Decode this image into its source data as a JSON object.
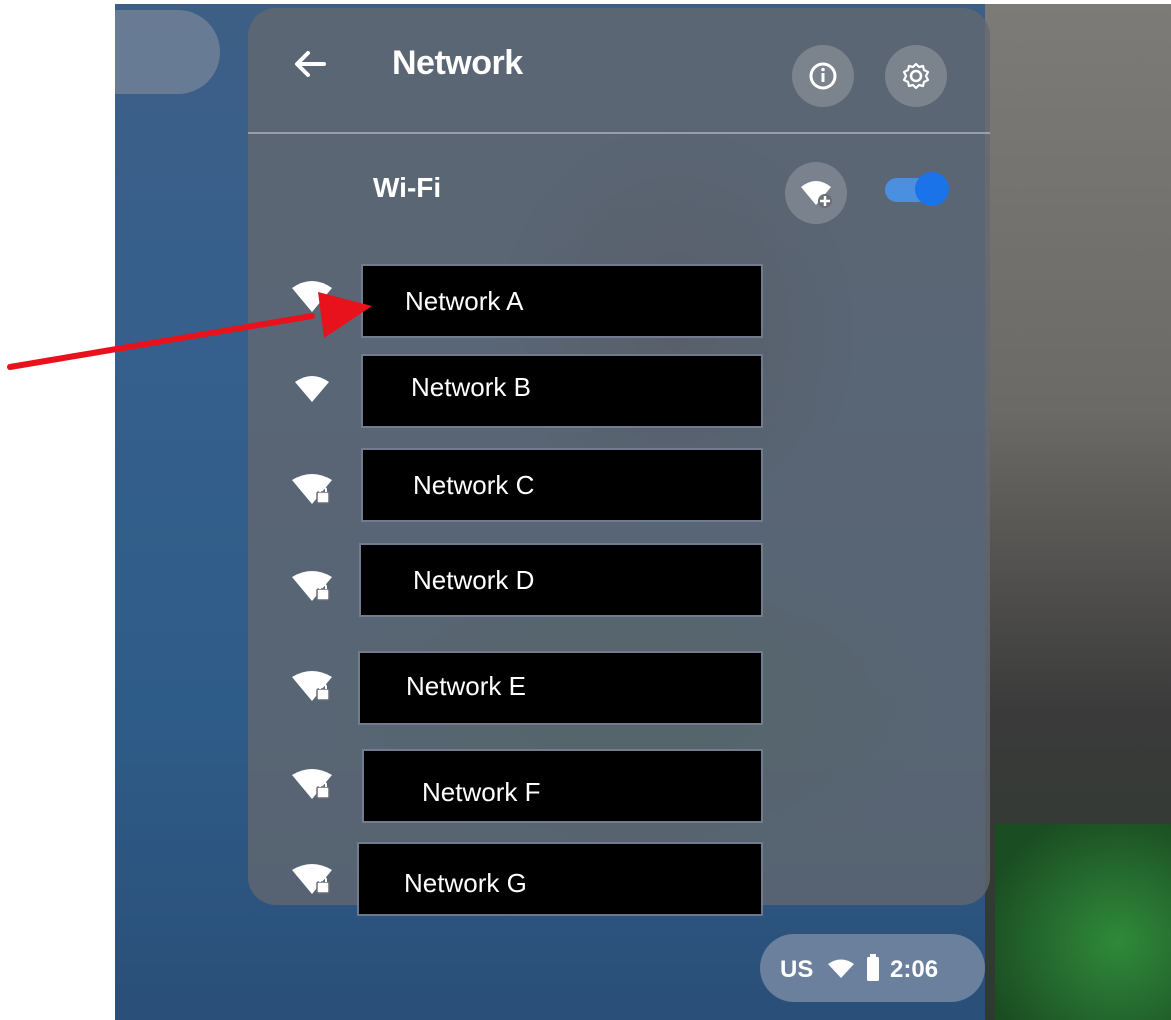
{
  "header": {
    "title": "Network",
    "back_icon": "arrow-left-icon",
    "info_icon": "info-icon",
    "settings_icon": "gear-icon"
  },
  "wifi": {
    "label": "Wi-Fi",
    "add_network_icon": "wifi-add-icon",
    "toggle_on": true
  },
  "networks": [
    {
      "name": "Network A",
      "icon": "wifi-signal-icon",
      "locked": false
    },
    {
      "name": "Network B",
      "icon": "wifi-signal-icon",
      "locked": false
    },
    {
      "name": "Network C",
      "icon": "wifi-locked-icon",
      "locked": true
    },
    {
      "name": "Network D",
      "icon": "wifi-locked-icon",
      "locked": true
    },
    {
      "name": "Network E",
      "icon": "wifi-locked-icon",
      "locked": true
    },
    {
      "name": "Network F",
      "icon": "wifi-locked-icon",
      "locked": true
    },
    {
      "name": "Network G",
      "icon": "wifi-locked-icon",
      "locked": true
    }
  ],
  "status_bar": {
    "keyboard": "US",
    "time": "2:06",
    "wifi_icon": "wifi-icon",
    "battery_icon": "battery-icon"
  },
  "annotation": {
    "arrow_color": "#e8121c",
    "accent_color": "#1a73e8"
  }
}
